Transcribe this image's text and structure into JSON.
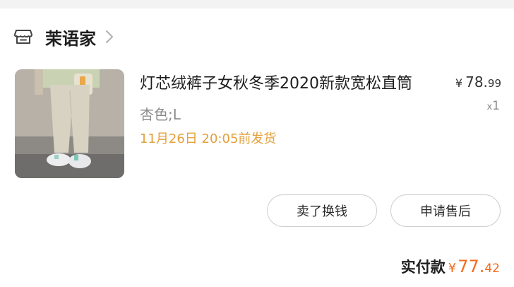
{
  "shop": {
    "icon": "store-icon",
    "name": "茉语家",
    "chevron_icon": "chevron-right-icon"
  },
  "item": {
    "image": "product-thumbnail",
    "title": "灯芯绒裤子女秋冬季2020新款宽松直筒",
    "variant": "杏色;L",
    "shipping": "11月26日 20:05前发货",
    "price_symbol": "¥",
    "price_int": "78.",
    "price_dec": "99",
    "qty_prefix": "x",
    "qty": "1"
  },
  "actions": {
    "sell_label": "卖了换钱",
    "after_sale_label": "申请售后"
  },
  "total": {
    "label": "实付款",
    "symbol": "¥",
    "amount_int": "77.",
    "amount_dec": "42"
  },
  "colors": {
    "shipping": "#e3a03b",
    "total": "#f26b1d"
  }
}
